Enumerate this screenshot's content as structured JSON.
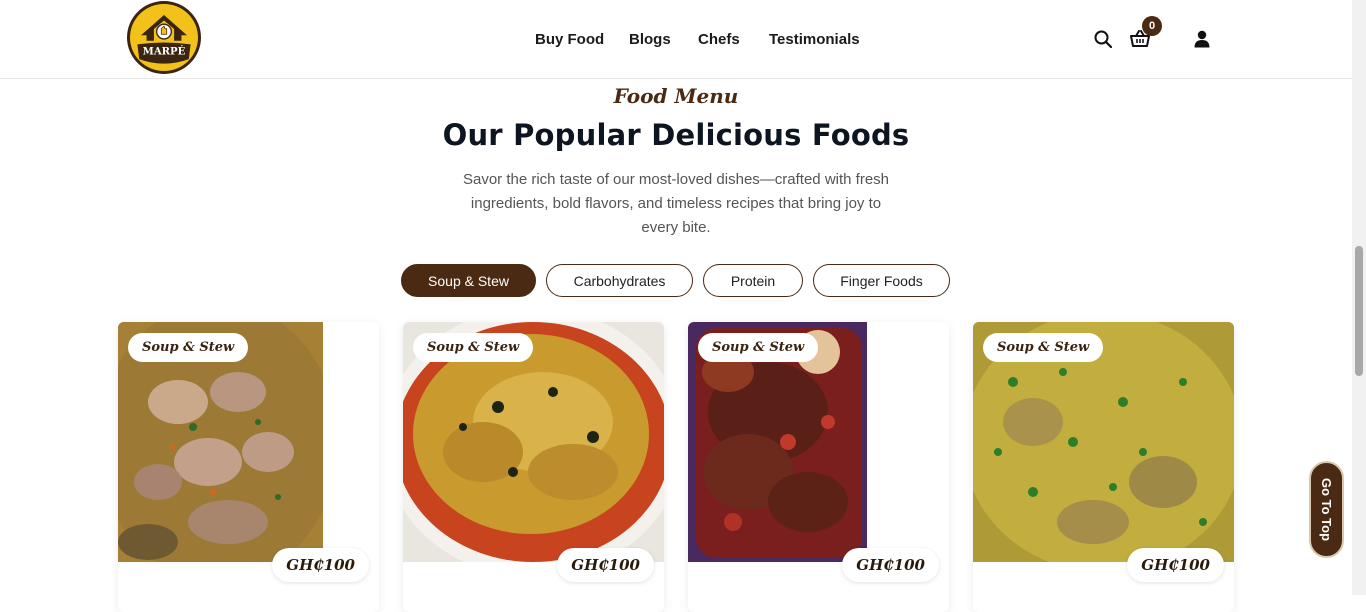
{
  "brand": {
    "logo_text": "MARPÉ"
  },
  "nav": {
    "items": [
      "Buy Food",
      "Blogs",
      "Chefs",
      "Testimonials"
    ]
  },
  "header": {
    "cart_count": "0",
    "icons": [
      "search-icon",
      "cart-icon",
      "user-icon"
    ]
  },
  "section": {
    "eyebrow": "Food Menu",
    "title": "Our Popular Delicious Foods",
    "description": "Savor the rich taste of our most-loved dishes—crafted with fresh ingredients, bold flavors, and timeless recipes that bring joy to every bite."
  },
  "tabs": [
    {
      "label": "Soup & Stew",
      "active": true
    },
    {
      "label": "Carbohydrates",
      "active": false
    },
    {
      "label": "Protein",
      "active": false
    },
    {
      "label": "Finger Foods",
      "active": false
    }
  ],
  "cards": [
    {
      "tag": "Soup & Stew",
      "price": "GH₵100"
    },
    {
      "tag": "Soup & Stew",
      "price": "GH₵100"
    },
    {
      "tag": "Soup & Stew",
      "price": "GH₵100"
    },
    {
      "tag": "Soup & Stew",
      "price": "GH₵100"
    }
  ],
  "go_to_top": "Go To Top",
  "colors": {
    "brand_brown": "#4a2a12",
    "logo_yellow": "#f2c21b",
    "heading": "#0d1520"
  }
}
